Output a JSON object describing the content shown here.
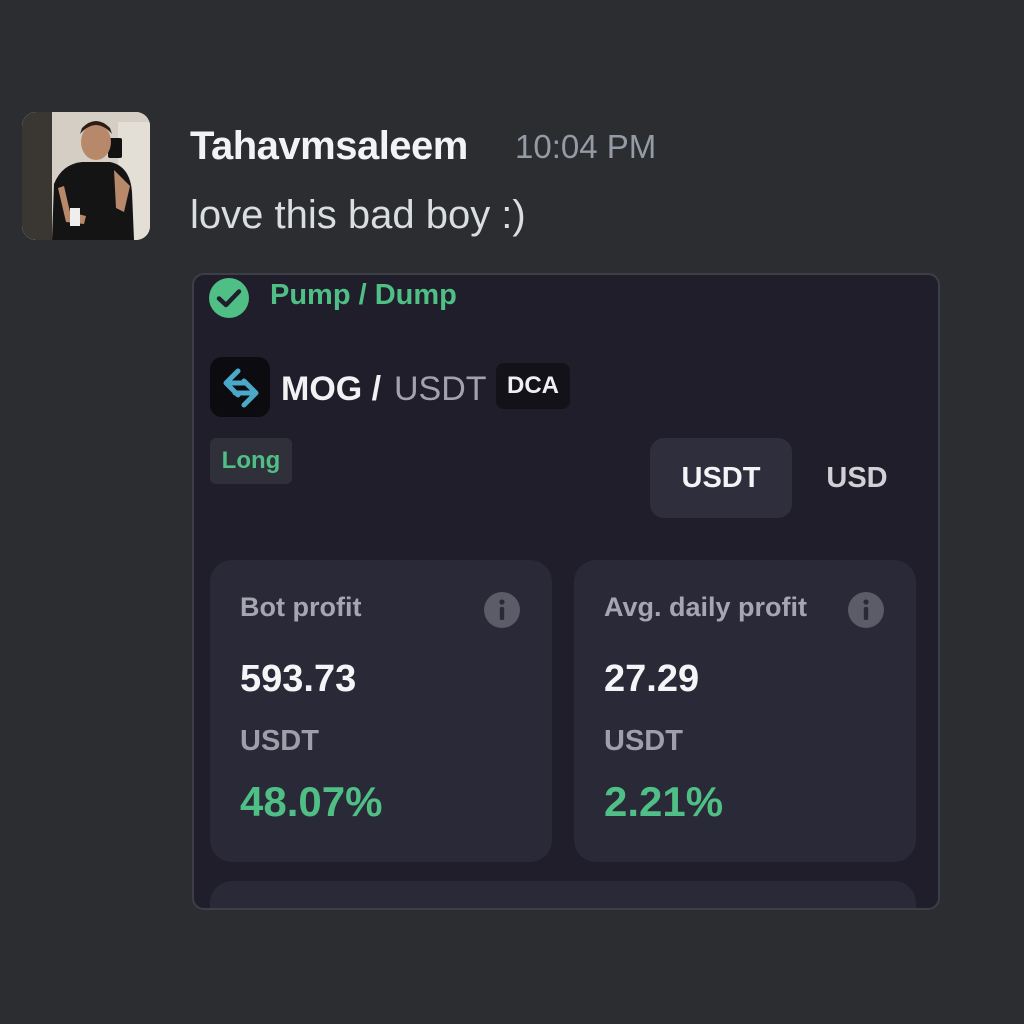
{
  "message": {
    "username": "Tahavmsaleem",
    "timestamp": "10:04 PM",
    "text": "love this bad boy :)"
  },
  "embed": {
    "status_icon": "check-circle-icon",
    "status_label": "Pump / Dump",
    "pair": {
      "logo_icon": "exchange-arrows-icon",
      "base": "MOG /",
      "quote": "USDT",
      "badge": "DCA"
    },
    "direction_badge": "Long",
    "currency_toggle": {
      "options": [
        "USDT",
        "USD"
      ],
      "selected": "USDT"
    },
    "stats": [
      {
        "title": "Bot profit",
        "value": "593.73",
        "unit": "USDT",
        "percent": "48.07%"
      },
      {
        "title": "Avg. daily profit",
        "value": "27.29",
        "unit": "USDT",
        "percent": "2.21%"
      }
    ]
  },
  "colors": {
    "background": "#2b2d31",
    "embed_bg": "#1f1e2a",
    "card_bg": "#2a2937",
    "positive": "#4fbf86",
    "logo_accent": "#4aa8c9"
  }
}
